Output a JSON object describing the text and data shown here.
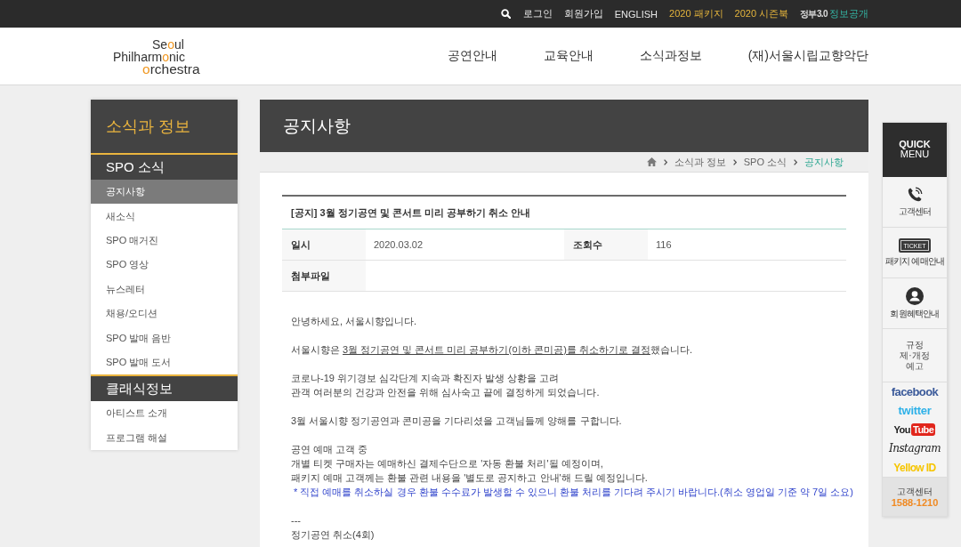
{
  "topbar": {
    "links": [
      {
        "label": "로그인",
        "kind": "plain"
      },
      {
        "label": "회원가입",
        "kind": "plain"
      },
      {
        "label": "ENGLISH",
        "kind": "plain"
      },
      {
        "label": "2020 패키지",
        "kind": "featured"
      },
      {
        "label": "2020 시즌북",
        "kind": "featured"
      },
      {
        "label": "정보공개",
        "kind": "gov",
        "badge": "정부3.0"
      }
    ]
  },
  "header": {
    "logo": [
      [
        {
          "text": "Se",
          "accent": false
        },
        {
          "text": "o",
          "accent": true
        },
        {
          "text": "ul",
          "accent": false
        }
      ],
      [
        {
          "text": "Philharm",
          "accent": false
        },
        {
          "text": "o",
          "accent": true
        },
        {
          "text": "nic",
          "accent": false
        }
      ],
      [
        {
          "text": "o",
          "accent": true
        },
        {
          "text": "rchestra",
          "accent": false
        }
      ]
    ],
    "nav": [
      "공연안내",
      "교육안내",
      "소식과정보",
      "(재)서울시립교향악단"
    ]
  },
  "sidebar": {
    "title": "소식과 정보",
    "sections": [
      {
        "title": "SPO 소식",
        "items": [
          {
            "label": "공지사항",
            "selected": true
          },
          {
            "label": "새소식",
            "selected": false
          },
          {
            "label": "SPO 매거진",
            "selected": false
          },
          {
            "label": "SPO 영상",
            "selected": false
          },
          {
            "label": "뉴스레터",
            "selected": false
          },
          {
            "label": "채용/오디션",
            "selected": false
          },
          {
            "label": "SPO 발매 음반",
            "selected": false
          },
          {
            "label": "SPO 발매 도서",
            "selected": false
          }
        ]
      },
      {
        "title": "클래식정보",
        "items": [
          {
            "label": "아티스트 소개",
            "selected": false
          },
          {
            "label": "프로그램 해설",
            "selected": false
          }
        ]
      }
    ]
  },
  "main": {
    "title": "공지사항",
    "breadcrumb": [
      {
        "label": "소식과 정보",
        "current": false
      },
      {
        "label": "SPO 소식",
        "current": false
      },
      {
        "label": "공지사항",
        "current": true
      }
    ],
    "post": {
      "title": "[공지] 3월 정기공연 및 콘서트 미리 공부하기 취소 안내",
      "meta": [
        [
          {
            "label": "일시",
            "value": "2020.03.02"
          },
          {
            "label": "조회수",
            "value": "116"
          }
        ],
        [
          {
            "label": "첨부파일"
          }
        ]
      ],
      "body": [
        {
          "kind": "text",
          "lines": [
            [
              {
                "text": "안녕하세요, 서울시향입니다.",
                "underline": false
              }
            ]
          ]
        },
        {
          "kind": "text",
          "lines": [
            [
              {
                "text": "서울시향은 ",
                "underline": false
              },
              {
                "text": "3월 정기공연 및 콘서트 미리 공부하기(이하 콘미공)를 취소하기로 결정",
                "underline": true
              },
              {
                "text": "했습니다.",
                "underline": false
              }
            ]
          ]
        },
        {
          "kind": "text",
          "lines": [
            [
              {
                "text": "코로나-19 위기경보 심각단계 지속과 확진자 발생 상황을 고려",
                "underline": false
              }
            ],
            [
              {
                "text": "관객 여러분의 건강과 안전을 위해 심사숙고 끝에 결정하게 되었습니다.",
                "underline": false
              }
            ]
          ]
        },
        {
          "kind": "text",
          "lines": [
            [
              {
                "text": "3월 서울시향 정기공연과 콘미공을 기다리셨을 고객님들께 양해를 구합니다.",
                "underline": false
              }
            ]
          ]
        },
        {
          "kind": "text",
          "lines": [
            [
              {
                "text": "공연 예매 고객 중",
                "underline": false
              }
            ],
            [
              {
                "text": "개별 티켓 구매자는 예매하신 결제수단으로 '자동 환불 처리'될 예정이며,",
                "underline": false
              }
            ],
            [
              {
                "text": "패키지 예매 고객께는 환불 관련 내용을 '별도로 공지하고 안내'해 드릴 예정입니다.",
                "underline": false
              }
            ]
          ]
        },
        {
          "kind": "note",
          "lines": [
            [
              {
                "text": "* 직접 예매를 취소하실 경우 환불 수수료가 발생할 수 있으니 환불 처리를 기다려 주시기 바랍니다.(취소 영업일 기준 약 7일 소요)",
                "underline": false
              }
            ]
          ]
        },
        {
          "kind": "text",
          "lines": [
            [
              {
                "text": "---",
                "underline": false
              }
            ],
            [
              {
                "text": "정기공연 취소(4회)",
                "underline": false
              }
            ]
          ]
        }
      ]
    }
  },
  "quick_menu": {
    "title": [
      "QUICK",
      "MENU"
    ],
    "items": [
      {
        "kind": "phone",
        "lines": [
          "고객센터"
        ]
      },
      {
        "kind": "ticket",
        "icon_text": "TICKET",
        "lines": [
          "패키지 예매안내"
        ]
      },
      {
        "kind": "member",
        "lines": [
          "회원혜택안내"
        ]
      },
      {
        "kind": "text",
        "lines": [
          "규정",
          "제·개정",
          "예고"
        ]
      }
    ],
    "social": [
      {
        "kind": "facebook",
        "label": "facebook"
      },
      {
        "kind": "twitter",
        "label": "twitter"
      },
      {
        "kind": "youtube",
        "label": "You",
        "badge": "Tube"
      },
      {
        "kind": "instagram",
        "label": "Instagram"
      },
      {
        "kind": "yellowid",
        "label": "Yellow ID"
      }
    ],
    "contact": {
      "label": "고객센터",
      "phone": "1588-1210"
    }
  }
}
